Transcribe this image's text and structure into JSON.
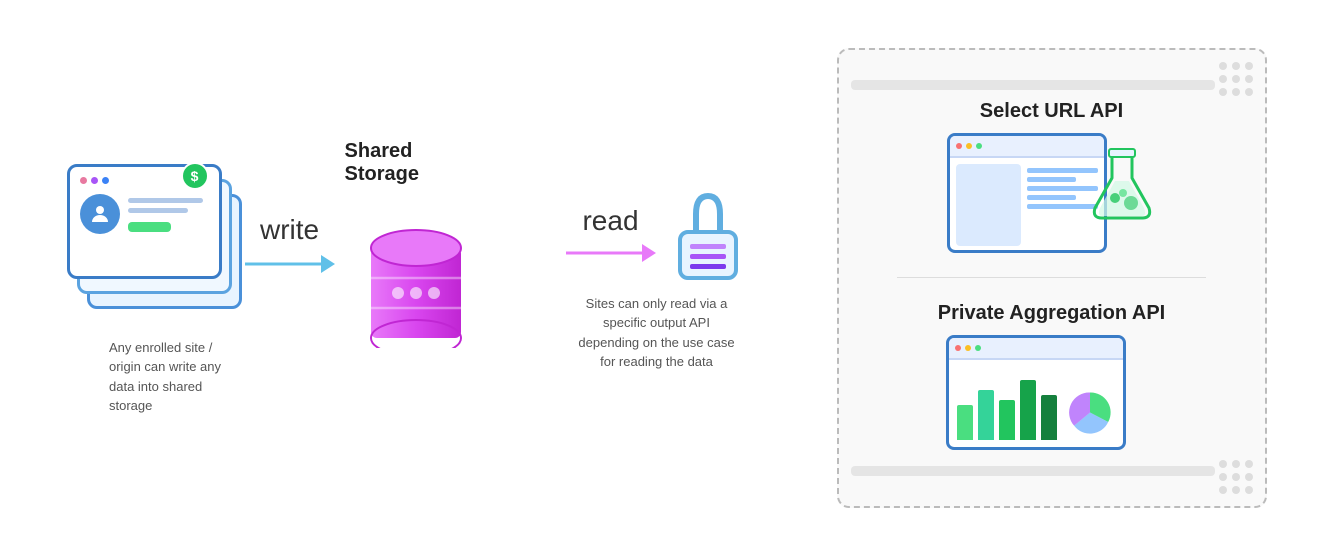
{
  "diagram": {
    "shared_storage_label": "Shared Storage",
    "write_label": "write",
    "read_label": "read",
    "write_desc": "Any enrolled site / origin can write any data into shared storage",
    "read_desc": "Sites can only read via a specific output API depending on the use case for reading the data",
    "api_panel": {
      "title1": "Select URL API",
      "title2": "Private Aggregation API"
    },
    "card": {
      "dot1": "pink",
      "dot2": "purple",
      "dot3": "blue"
    },
    "dollar_symbol": "$"
  }
}
